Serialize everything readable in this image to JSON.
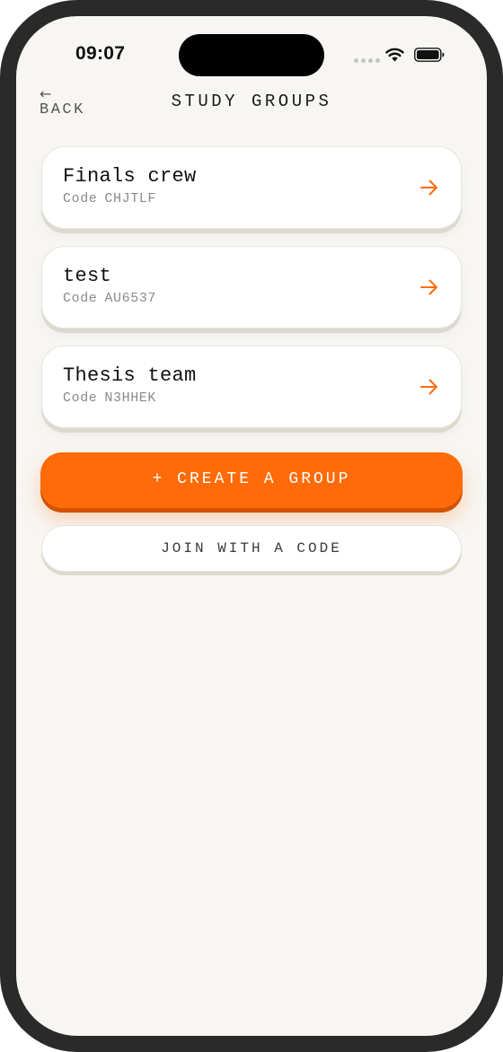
{
  "status_bar": {
    "time": "09:07",
    "icons": [
      "cellular-dots-icon",
      "wifi-icon",
      "battery-icon"
    ]
  },
  "header": {
    "back_arrow": "←",
    "back_label": "BACK",
    "title": "STUDY GROUPS"
  },
  "groups": [
    {
      "name": "Finals crew",
      "code_label": "Code",
      "code": "CHJTLF"
    },
    {
      "name": "test",
      "code_label": "Code",
      "code": "AU6537"
    },
    {
      "name": "Thesis team",
      "code_label": "Code",
      "code": "N3HHEK"
    }
  ],
  "actions": {
    "create_label": "+ CREATE A GROUP",
    "join_label": "JOIN WITH A CODE"
  },
  "colors": {
    "accent": "#ff6b08",
    "background": "#f7f6f2",
    "card": "#ffffff",
    "muted_text": "#8a8a8a"
  }
}
